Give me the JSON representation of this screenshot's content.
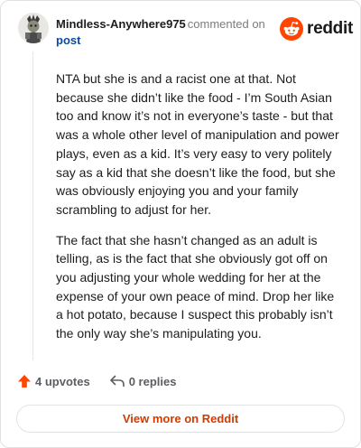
{
  "comment": {
    "username": "Mindless-Anywhere975",
    "action": "commented on",
    "post_link": "post",
    "paragraphs": [
      "NTA but she is and a racist one at that. Not because she didn’t like the food - I’m South Asian too and know it’s not in everyone’s taste - but that was a whole other level of manipulation and power plays, even as a kid. It’s very easy to very politely say as a kid that she doesn’t like the food, but she was obviously enjoying you and your family scrambling to adjust for her.",
      "The fact that she hasn’t changed as an adult is telling, as is the fact that she obviously got off on you adjusting your whole wedding for her at the expense of your own peace of mind. Drop her like a hot potato, because I suspect this probably isn’t the only way she’s manipulating you."
    ]
  },
  "brand": {
    "wordmark": "reddit",
    "icon": "reddit-snoo-icon",
    "color": "#ff4500"
  },
  "footer": {
    "upvotes": "4 upvotes",
    "replies": "0 replies",
    "upvote_icon": "upvote-arrow-icon",
    "reply_icon": "reply-arrow-icon",
    "upvote_color": "#ff4500"
  },
  "cta": {
    "label": "View more on Reddit",
    "color": "#d33a00"
  }
}
